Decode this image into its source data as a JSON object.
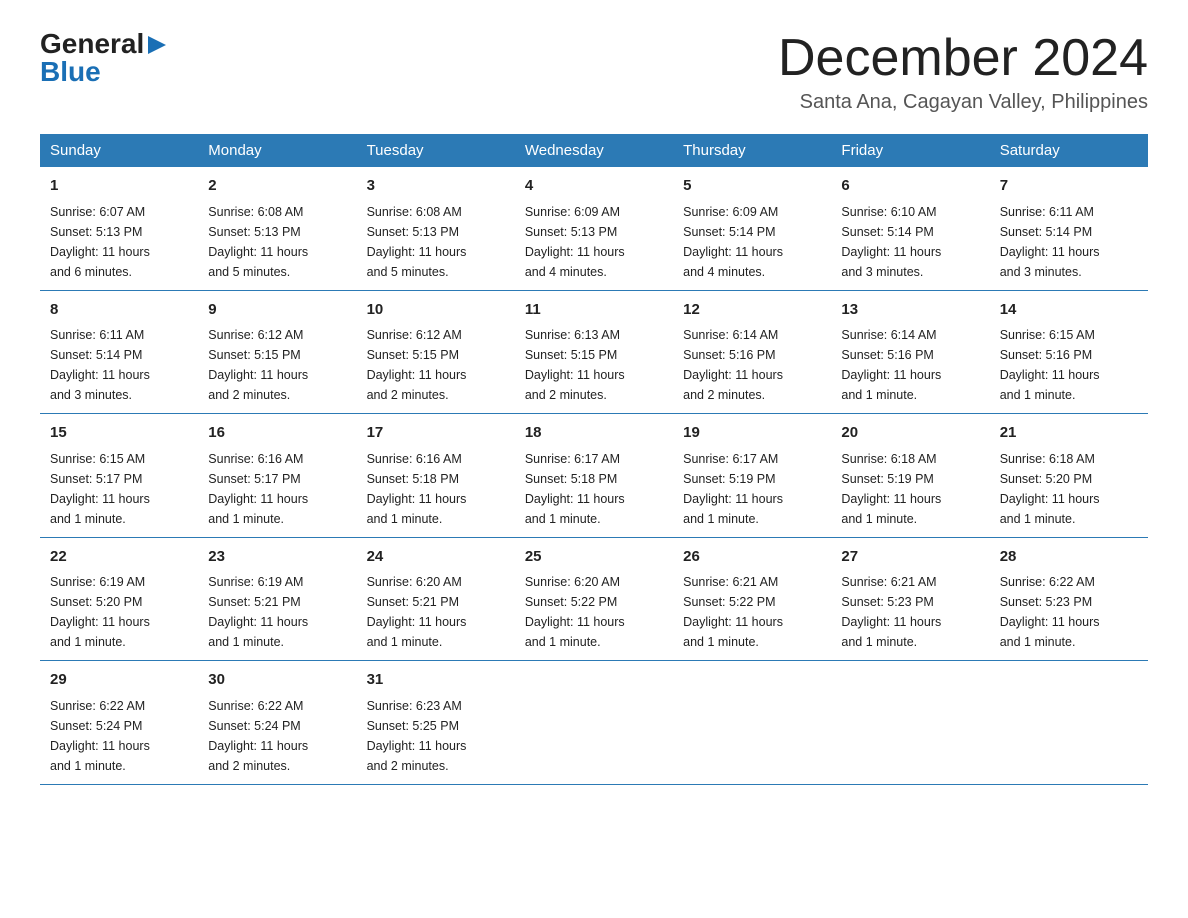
{
  "logo": {
    "general": "General",
    "blue": "Blue"
  },
  "title": "December 2024",
  "location": "Santa Ana, Cagayan Valley, Philippines",
  "days_of_week": [
    "Sunday",
    "Monday",
    "Tuesday",
    "Wednesday",
    "Thursday",
    "Friday",
    "Saturday"
  ],
  "weeks": [
    [
      {
        "day": "1",
        "sunrise": "6:07 AM",
        "sunset": "5:13 PM",
        "daylight": "11 hours and 6 minutes."
      },
      {
        "day": "2",
        "sunrise": "6:08 AM",
        "sunset": "5:13 PM",
        "daylight": "11 hours and 5 minutes."
      },
      {
        "day": "3",
        "sunrise": "6:08 AM",
        "sunset": "5:13 PM",
        "daylight": "11 hours and 5 minutes."
      },
      {
        "day": "4",
        "sunrise": "6:09 AM",
        "sunset": "5:13 PM",
        "daylight": "11 hours and 4 minutes."
      },
      {
        "day": "5",
        "sunrise": "6:09 AM",
        "sunset": "5:14 PM",
        "daylight": "11 hours and 4 minutes."
      },
      {
        "day": "6",
        "sunrise": "6:10 AM",
        "sunset": "5:14 PM",
        "daylight": "11 hours and 3 minutes."
      },
      {
        "day": "7",
        "sunrise": "6:11 AM",
        "sunset": "5:14 PM",
        "daylight": "11 hours and 3 minutes."
      }
    ],
    [
      {
        "day": "8",
        "sunrise": "6:11 AM",
        "sunset": "5:14 PM",
        "daylight": "11 hours and 3 minutes."
      },
      {
        "day": "9",
        "sunrise": "6:12 AM",
        "sunset": "5:15 PM",
        "daylight": "11 hours and 2 minutes."
      },
      {
        "day": "10",
        "sunrise": "6:12 AM",
        "sunset": "5:15 PM",
        "daylight": "11 hours and 2 minutes."
      },
      {
        "day": "11",
        "sunrise": "6:13 AM",
        "sunset": "5:15 PM",
        "daylight": "11 hours and 2 minutes."
      },
      {
        "day": "12",
        "sunrise": "6:14 AM",
        "sunset": "5:16 PM",
        "daylight": "11 hours and 2 minutes."
      },
      {
        "day": "13",
        "sunrise": "6:14 AM",
        "sunset": "5:16 PM",
        "daylight": "11 hours and 1 minute."
      },
      {
        "day": "14",
        "sunrise": "6:15 AM",
        "sunset": "5:16 PM",
        "daylight": "11 hours and 1 minute."
      }
    ],
    [
      {
        "day": "15",
        "sunrise": "6:15 AM",
        "sunset": "5:17 PM",
        "daylight": "11 hours and 1 minute."
      },
      {
        "day": "16",
        "sunrise": "6:16 AM",
        "sunset": "5:17 PM",
        "daylight": "11 hours and 1 minute."
      },
      {
        "day": "17",
        "sunrise": "6:16 AM",
        "sunset": "5:18 PM",
        "daylight": "11 hours and 1 minute."
      },
      {
        "day": "18",
        "sunrise": "6:17 AM",
        "sunset": "5:18 PM",
        "daylight": "11 hours and 1 minute."
      },
      {
        "day": "19",
        "sunrise": "6:17 AM",
        "sunset": "5:19 PM",
        "daylight": "11 hours and 1 minute."
      },
      {
        "day": "20",
        "sunrise": "6:18 AM",
        "sunset": "5:19 PM",
        "daylight": "11 hours and 1 minute."
      },
      {
        "day": "21",
        "sunrise": "6:18 AM",
        "sunset": "5:20 PM",
        "daylight": "11 hours and 1 minute."
      }
    ],
    [
      {
        "day": "22",
        "sunrise": "6:19 AM",
        "sunset": "5:20 PM",
        "daylight": "11 hours and 1 minute."
      },
      {
        "day": "23",
        "sunrise": "6:19 AM",
        "sunset": "5:21 PM",
        "daylight": "11 hours and 1 minute."
      },
      {
        "day": "24",
        "sunrise": "6:20 AM",
        "sunset": "5:21 PM",
        "daylight": "11 hours and 1 minute."
      },
      {
        "day": "25",
        "sunrise": "6:20 AM",
        "sunset": "5:22 PM",
        "daylight": "11 hours and 1 minute."
      },
      {
        "day": "26",
        "sunrise": "6:21 AM",
        "sunset": "5:22 PM",
        "daylight": "11 hours and 1 minute."
      },
      {
        "day": "27",
        "sunrise": "6:21 AM",
        "sunset": "5:23 PM",
        "daylight": "11 hours and 1 minute."
      },
      {
        "day": "28",
        "sunrise": "6:22 AM",
        "sunset": "5:23 PM",
        "daylight": "11 hours and 1 minute."
      }
    ],
    [
      {
        "day": "29",
        "sunrise": "6:22 AM",
        "sunset": "5:24 PM",
        "daylight": "11 hours and 1 minute."
      },
      {
        "day": "30",
        "sunrise": "6:22 AM",
        "sunset": "5:24 PM",
        "daylight": "11 hours and 2 minutes."
      },
      {
        "day": "31",
        "sunrise": "6:23 AM",
        "sunset": "5:25 PM",
        "daylight": "11 hours and 2 minutes."
      },
      null,
      null,
      null,
      null
    ]
  ],
  "labels": {
    "sunrise": "Sunrise:",
    "sunset": "Sunset:",
    "daylight": "Daylight:"
  }
}
